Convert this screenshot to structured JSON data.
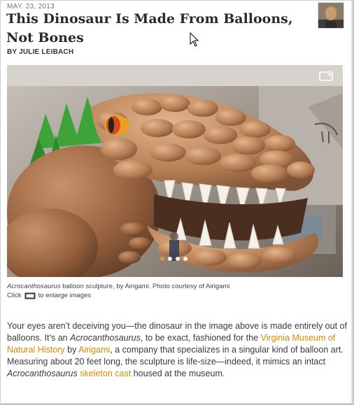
{
  "article": {
    "date": "MAY. 23, 2013",
    "title": "This Dinosaur Is Made From Balloons, Not Bones",
    "byline": "BY JULIE LEIBACH"
  },
  "slideshow": {
    "slide_count": 4,
    "active_slide": 1
  },
  "caption": {
    "species": "Acrocanthosaurus",
    "text": " balloon sculpture, by Airigami. Photo courtesy of Airigami",
    "hint_prefix": "Click",
    "hint_suffix": "to enlarge images"
  },
  "body": {
    "p1": "Your eyes aren’t deceiving you—the dinosaur in the image above is made entirely out of balloons. It’s an ",
    "species1": "Acrocanthosaurus",
    "p2": ", to be exact, fashioned for the ",
    "link_museum": "Virginia Museum of Natural History",
    "p3": " by ",
    "link_company": "Airigami",
    "p4": ", a company that specializes in a singular kind of balloon art. Measuring about 20 feet long, the sculpture is life-size—indeed, it mimics an intact ",
    "species2": "Acrocanthosaurus",
    "p5": " ",
    "link_skeleton": "skeleton cast",
    "p6": " housed at the museum."
  },
  "colors": {
    "link": "#d98a00",
    "active_dot": "#f39c12"
  }
}
